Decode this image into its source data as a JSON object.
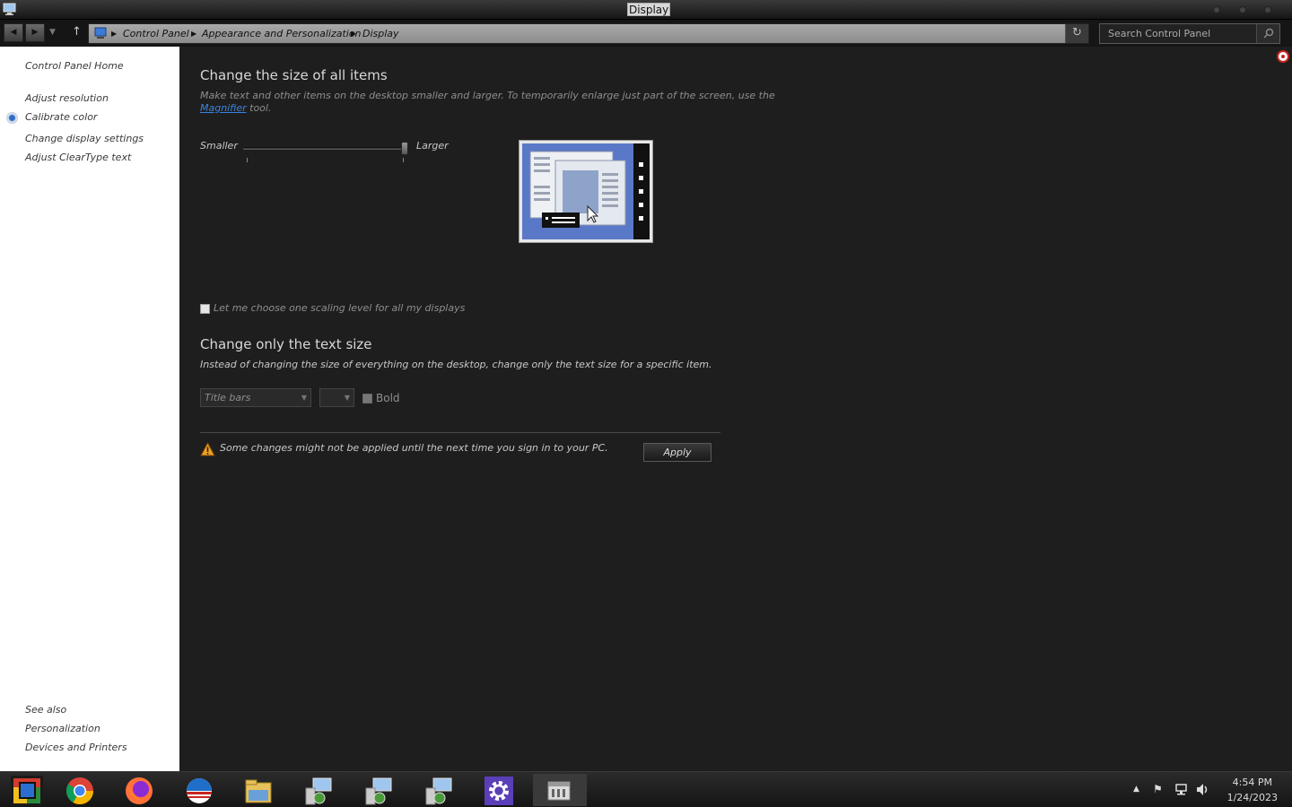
{
  "window": {
    "title": "Display"
  },
  "nav": {
    "breadcrumb": [
      "Control Panel",
      "Appearance and Personalization",
      "Display"
    ],
    "search_placeholder": "Search Control Panel"
  },
  "sidebar": {
    "home": "Control Panel Home",
    "links": [
      "Adjust resolution",
      "Calibrate color",
      "Change display settings",
      "Adjust ClearType text"
    ],
    "see_also_title": "See also",
    "see_also": [
      "Personalization",
      "Devices and Printers"
    ]
  },
  "main": {
    "section1_title": "Change the size of all items",
    "section1_desc_line1": "Make text and other items on the desktop smaller and larger. To temporarily enlarge just part of the screen, use the",
    "section1_desc_link": "Magnifier",
    "section1_desc_end": "tool.",
    "slider_min_label": "Smaller",
    "slider_max_label": "Larger",
    "slider_level_fraction": 1.0,
    "scaling_checkbox_label": "Let me choose one scaling level for all my displays",
    "scaling_checkbox_checked": false,
    "section2_title": "Change only the text size",
    "section2_desc": "Instead of changing the size of everything on the desktop, change only the text size for a specific item.",
    "item_dropdown_value": "Title bars",
    "size_dropdown_value": "",
    "bold_label": "Bold",
    "bold_checked": false,
    "warning": "Some changes might not be applied until the next time you sign in to your PC.",
    "apply_label": "Apply"
  },
  "taskbar": {
    "apps": [
      "start-icon",
      "chrome-icon",
      "firefox-icon",
      "app-circle-icon",
      "file-explorer-icon",
      "network-app-icon",
      "network-app-icon",
      "network-app-icon",
      "settings-gear-icon",
      "control-panel-icon"
    ],
    "time": "4:54 PM",
    "date": "1/24/2023"
  },
  "colors": {
    "main_bg": "#1e1e1e",
    "sidebar_bg": "#ffffff",
    "link": "#3b82e0",
    "warning": "#f0a020"
  }
}
